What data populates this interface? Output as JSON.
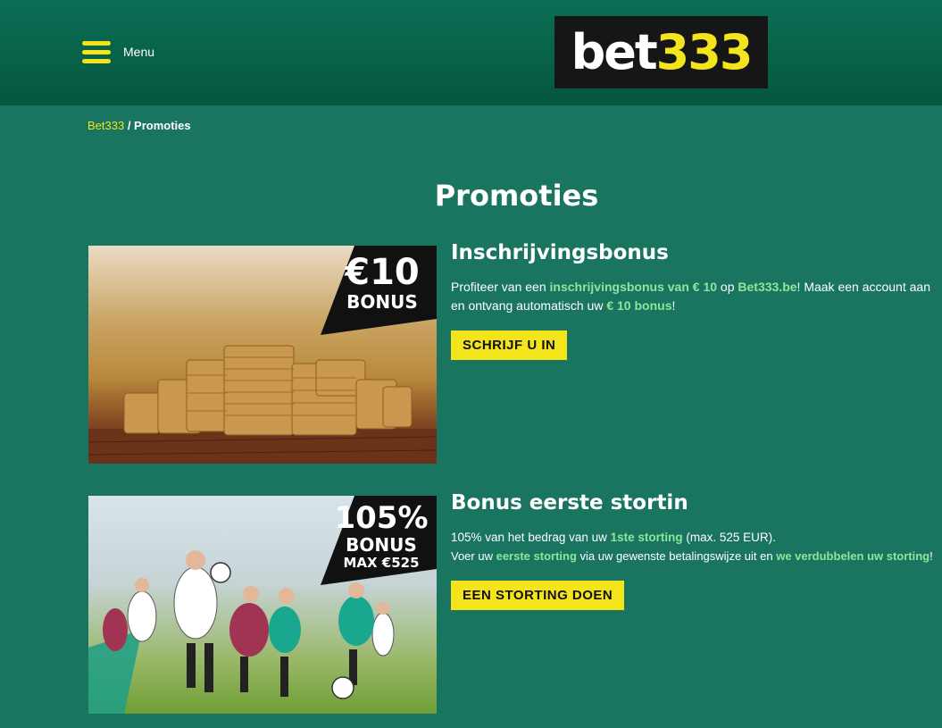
{
  "header": {
    "menu_label": "Menu",
    "logo_white": "bet",
    "logo_yellow": "333"
  },
  "breadcrumb": {
    "home": "Bet333",
    "separator": " / ",
    "current": "Promoties"
  },
  "page_title": "Promoties",
  "promos": [
    {
      "title": "Inschrijvingsbonus",
      "badge_line1": "€10",
      "badge_line2": "BONUS",
      "desc": {
        "t1": "Profiteer van een ",
        "h1": "inschrijvingsbonus van € 10",
        "t2": " op ",
        "h2": "Bet333.be",
        "t3": "! Maak een account aan en ontvang automatisch uw ",
        "h3": "€ 10 bonus",
        "t4": "!"
      },
      "button": "SCHRIJF U IN"
    },
    {
      "title": "Bonus eerste stortin",
      "badge_line1": "105%",
      "badge_line2": "BONUS",
      "badge_line3": "MAX €525",
      "desc": {
        "t1": "105% van het bedrag van uw ",
        "h1": "1ste storting",
        "t2": " (max. 525 EUR).",
        "t3": "Voer uw ",
        "h2": "eerste storting",
        "t4": " via uw gewenste betalingswijze uit en ",
        "h3": "we verdubbelen uw storting",
        "t5": "!"
      },
      "button": "EEN STORTING DOEN"
    }
  ],
  "colors": {
    "page_bg": "#1a7560",
    "header_bg": "#05573f",
    "accent_yellow": "#f4e41c",
    "highlight_green": "#8fe59b"
  },
  "icons": {
    "menu": "hamburger-icon"
  }
}
